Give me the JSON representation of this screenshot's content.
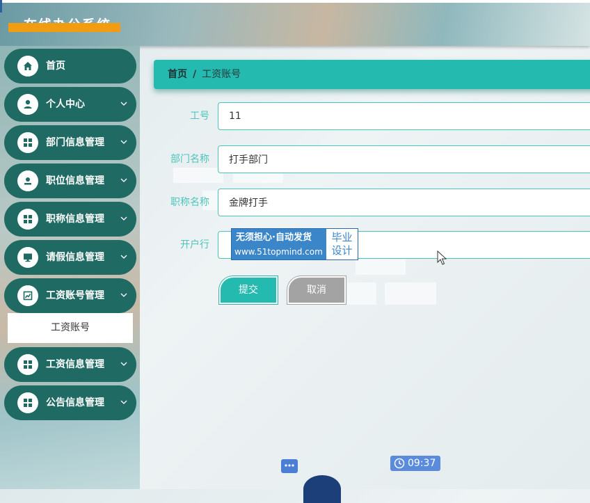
{
  "app": {
    "title": "在线办公系统"
  },
  "sidebar": {
    "items": [
      {
        "label": "首页",
        "icon": "home-icon",
        "expandable": false
      },
      {
        "label": "个人中心",
        "icon": "user-icon",
        "expandable": true
      },
      {
        "label": "部门信息管理",
        "icon": "grid-icon",
        "expandable": true
      },
      {
        "label": "职位信息管理",
        "icon": "person-badge-icon",
        "expandable": true
      },
      {
        "label": "职称信息管理",
        "icon": "grid-icon",
        "expandable": true
      },
      {
        "label": "请假信息管理",
        "icon": "monitor-icon",
        "expandable": true
      },
      {
        "label": "工资账号管理",
        "icon": "chart-icon",
        "expandable": true
      },
      {
        "label": "工资信息管理",
        "icon": "grid-icon",
        "expandable": true
      },
      {
        "label": "公告信息管理",
        "icon": "grid-icon",
        "expandable": true
      }
    ],
    "submenu": {
      "label": "工资账号"
    }
  },
  "breadcrumb": {
    "home": "首页",
    "separator": "/",
    "current": "工资账号"
  },
  "form": {
    "fields": [
      {
        "label": "工号",
        "value": "11"
      },
      {
        "label": "部门名称",
        "value": "打手部门"
      },
      {
        "label": "职称名称",
        "value": "金牌打手"
      },
      {
        "label": "开户行",
        "value": ""
      }
    ],
    "submit_label": "提交",
    "cancel_label": "取消"
  },
  "watermark": {
    "line1": "无须担心·自动发货",
    "line2": "www.51topmind.com",
    "side_top": "毕业",
    "side_bottom": "设计"
  },
  "overlay": {
    "time": "09:37"
  },
  "colors": {
    "accent": "#25bab0",
    "sidebar_item": "#1f6b64",
    "cancel": "#a3a3a3",
    "title_bar": "#f29c12"
  }
}
